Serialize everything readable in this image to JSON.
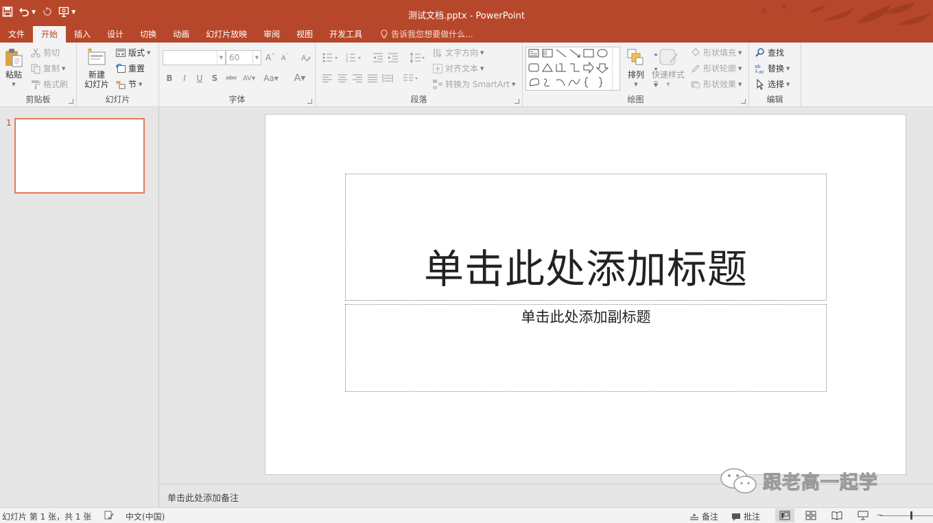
{
  "window": {
    "title": "测试文档.pptx - PowerPoint"
  },
  "tabs": [
    {
      "label": "文件"
    },
    {
      "label": "开始",
      "active": true
    },
    {
      "label": "插入"
    },
    {
      "label": "设计"
    },
    {
      "label": "切换"
    },
    {
      "label": "动画"
    },
    {
      "label": "幻灯片放映"
    },
    {
      "label": "审阅"
    },
    {
      "label": "视图"
    },
    {
      "label": "开发工具"
    }
  ],
  "tell_me": {
    "placeholder": "告诉我您想要做什么..."
  },
  "ribbon": {
    "clipboard": {
      "label": "剪贴板",
      "paste": "粘贴",
      "cut": "剪切",
      "copy": "复制",
      "format_painter": "格式刷"
    },
    "slides": {
      "label": "幻灯片",
      "new_slide_line1": "新建",
      "new_slide_line2": "幻灯片",
      "layout": "版式",
      "reset": "重置",
      "section": "节"
    },
    "font": {
      "label": "字体",
      "font_name": "",
      "font_size": "60"
    },
    "paragraph": {
      "label": "段落",
      "text_direction": "文字方向",
      "align_text": "对齐文本",
      "convert_smartart": "转换为 SmartArt"
    },
    "drawing": {
      "label": "绘图",
      "arrange": "排列",
      "quick_styles": "快速样式",
      "shape_fill": "形状填充",
      "shape_outline": "形状轮廓",
      "shape_effects": "形状效果"
    },
    "editing": {
      "label": "编辑",
      "find": "查找",
      "replace": "替换",
      "select": "选择"
    }
  },
  "thumbnails": [
    {
      "number": "1"
    }
  ],
  "slide": {
    "title_placeholder": "单击此处添加标题",
    "subtitle_placeholder": "单击此处添加副标题"
  },
  "notes": {
    "placeholder": "单击此处添加备注"
  },
  "watermark": {
    "text": "跟老高一起学"
  },
  "status": {
    "slide_info": "幻灯片 第 1 张，共 1 张",
    "language": "中文(中国)",
    "notes_label": "备注",
    "comments_label": "批注"
  },
  "colors": {
    "accent": "#b7472a",
    "thumbnail_border": "#e07a5a",
    "ribbon_bg": "#f3f3f3",
    "workspace_bg": "#e6e6e6"
  }
}
